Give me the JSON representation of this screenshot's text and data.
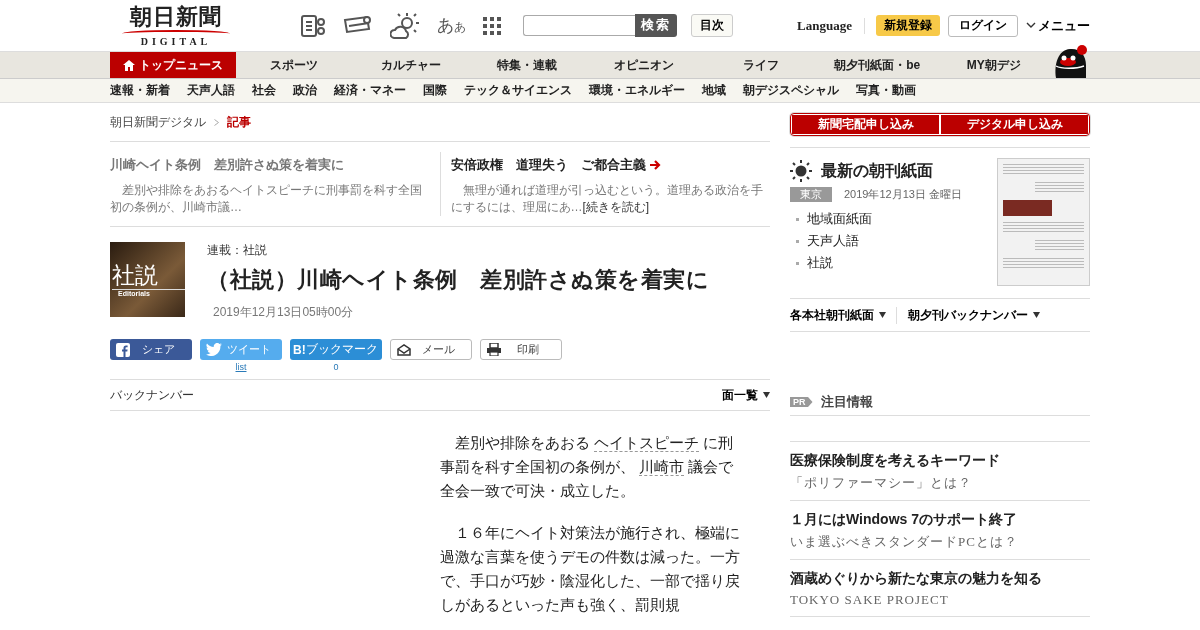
{
  "header": {
    "logo": {
      "title": "朝日新聞",
      "subtitle": "DIGITAL"
    },
    "font_size_button": {
      "large": "あ",
      "small": "あ"
    },
    "search": {
      "button": "検索"
    },
    "index_button": "目次",
    "language": "Language",
    "register": "新規登録",
    "login": "ログイン",
    "menu": "メニュー"
  },
  "main_nav": [
    {
      "label": "トップニュース",
      "selected": true
    },
    {
      "label": "スポーツ",
      "selected": false
    },
    {
      "label": "カルチャー",
      "selected": false
    },
    {
      "label": "特集・連載",
      "selected": false
    },
    {
      "label": "オピニオン",
      "selected": false
    },
    {
      "label": "ライフ",
      "selected": false
    },
    {
      "label": "朝夕刊紙面・be",
      "selected": false
    },
    {
      "label": "MY朝デジ",
      "selected": false
    }
  ],
  "sub_nav": [
    "速報・新着",
    "天声人語",
    "社会",
    "政治",
    "経済・マネー",
    "国際",
    "テック＆サイエンス",
    "環境・エネルギー",
    "地域",
    "朝デジスペシャル",
    "写真・動画"
  ],
  "breadcrumb": [
    "朝日新聞デジタル",
    "記事"
  ],
  "teasers": [
    {
      "title": "川崎ヘイト条例　差別許さぬ策を着実に",
      "summary": "　差別や排除をあおるヘイトスピーチに刑事罰を科す全国初の条例が、川崎市議…",
      "selected": true
    },
    {
      "title": "安倍政権　道理失う　ご都合主義",
      "summary": "　無理が通れば道理が引っ込むという。道理ある政治を手にするには、理屈にあ…",
      "more": "[続きを読む]",
      "selected": false
    }
  ],
  "article": {
    "badge": {
      "title": "社説",
      "subtitle": "Editorials"
    },
    "series": "連載：社説",
    "title": "（社説）川崎ヘイト条例　差別許さぬ策を着実に",
    "date": "2019年12月13日05時00分",
    "share": [
      {
        "kind": "facebook",
        "label": "シェア"
      },
      {
        "kind": "twitter",
        "label": "ツイート",
        "count": "list"
      },
      {
        "kind": "hatena",
        "label": "ブックマーク",
        "mark": "B!",
        "count": "0"
      },
      {
        "kind": "mail",
        "label": "メール"
      },
      {
        "kind": "print",
        "label": "印刷"
      }
    ],
    "back_number": "バックナンバー",
    "page_list": "面一覧",
    "paragraphs": [
      [
        {
          "kind": "text",
          "text": "　差別や排除をあおる "
        },
        {
          "kind": "link",
          "text": "ヘイトスピーチ"
        },
        {
          "kind": "text",
          "text": " に刑事罰を科す全国初の条例が、 "
        },
        {
          "kind": "link",
          "text": "川崎市"
        },
        {
          "kind": "text",
          "text": " 議会で全会一致で可決・成立した。"
        }
      ],
      [
        {
          "kind": "text",
          "text": "　１６年にヘイト対策法が施行され、極端に過激な言葉を使うデモの件数は減った。一方で、手口が巧妙・陰湿化した、一部で揺り戻しがあるといった声も強く、罰則規"
        }
      ]
    ]
  },
  "sidebar": {
    "subscribe": [
      "新聞宅配申し込み",
      "デジタル申し込み"
    ],
    "morning_paper": {
      "title": "最新の朝刊紙面",
      "region": "東京",
      "date": "2019年12月13日 金曜日",
      "links": [
        "地域面紙面",
        "天声人語",
        "社説"
      ]
    },
    "dropdowns": [
      "各本社朝刊紙面",
      "朝夕刊バックナンバー"
    ],
    "pr": {
      "tag": "PR",
      "title": "注目情報",
      "items": [
        {
          "title": "医療保険制度を考えるキーワード",
          "subtitle": "「ポリファーマシー」とは？"
        },
        {
          "title": "１月にはWindows 7のサポート終了",
          "subtitle": "いま選ぶべきスタンダードPCとは？"
        },
        {
          "title": "酒蔵めぐりから新たな東京の魅力を知る",
          "subtitle": "TOKYO SAKE PROJECT"
        }
      ]
    }
  }
}
